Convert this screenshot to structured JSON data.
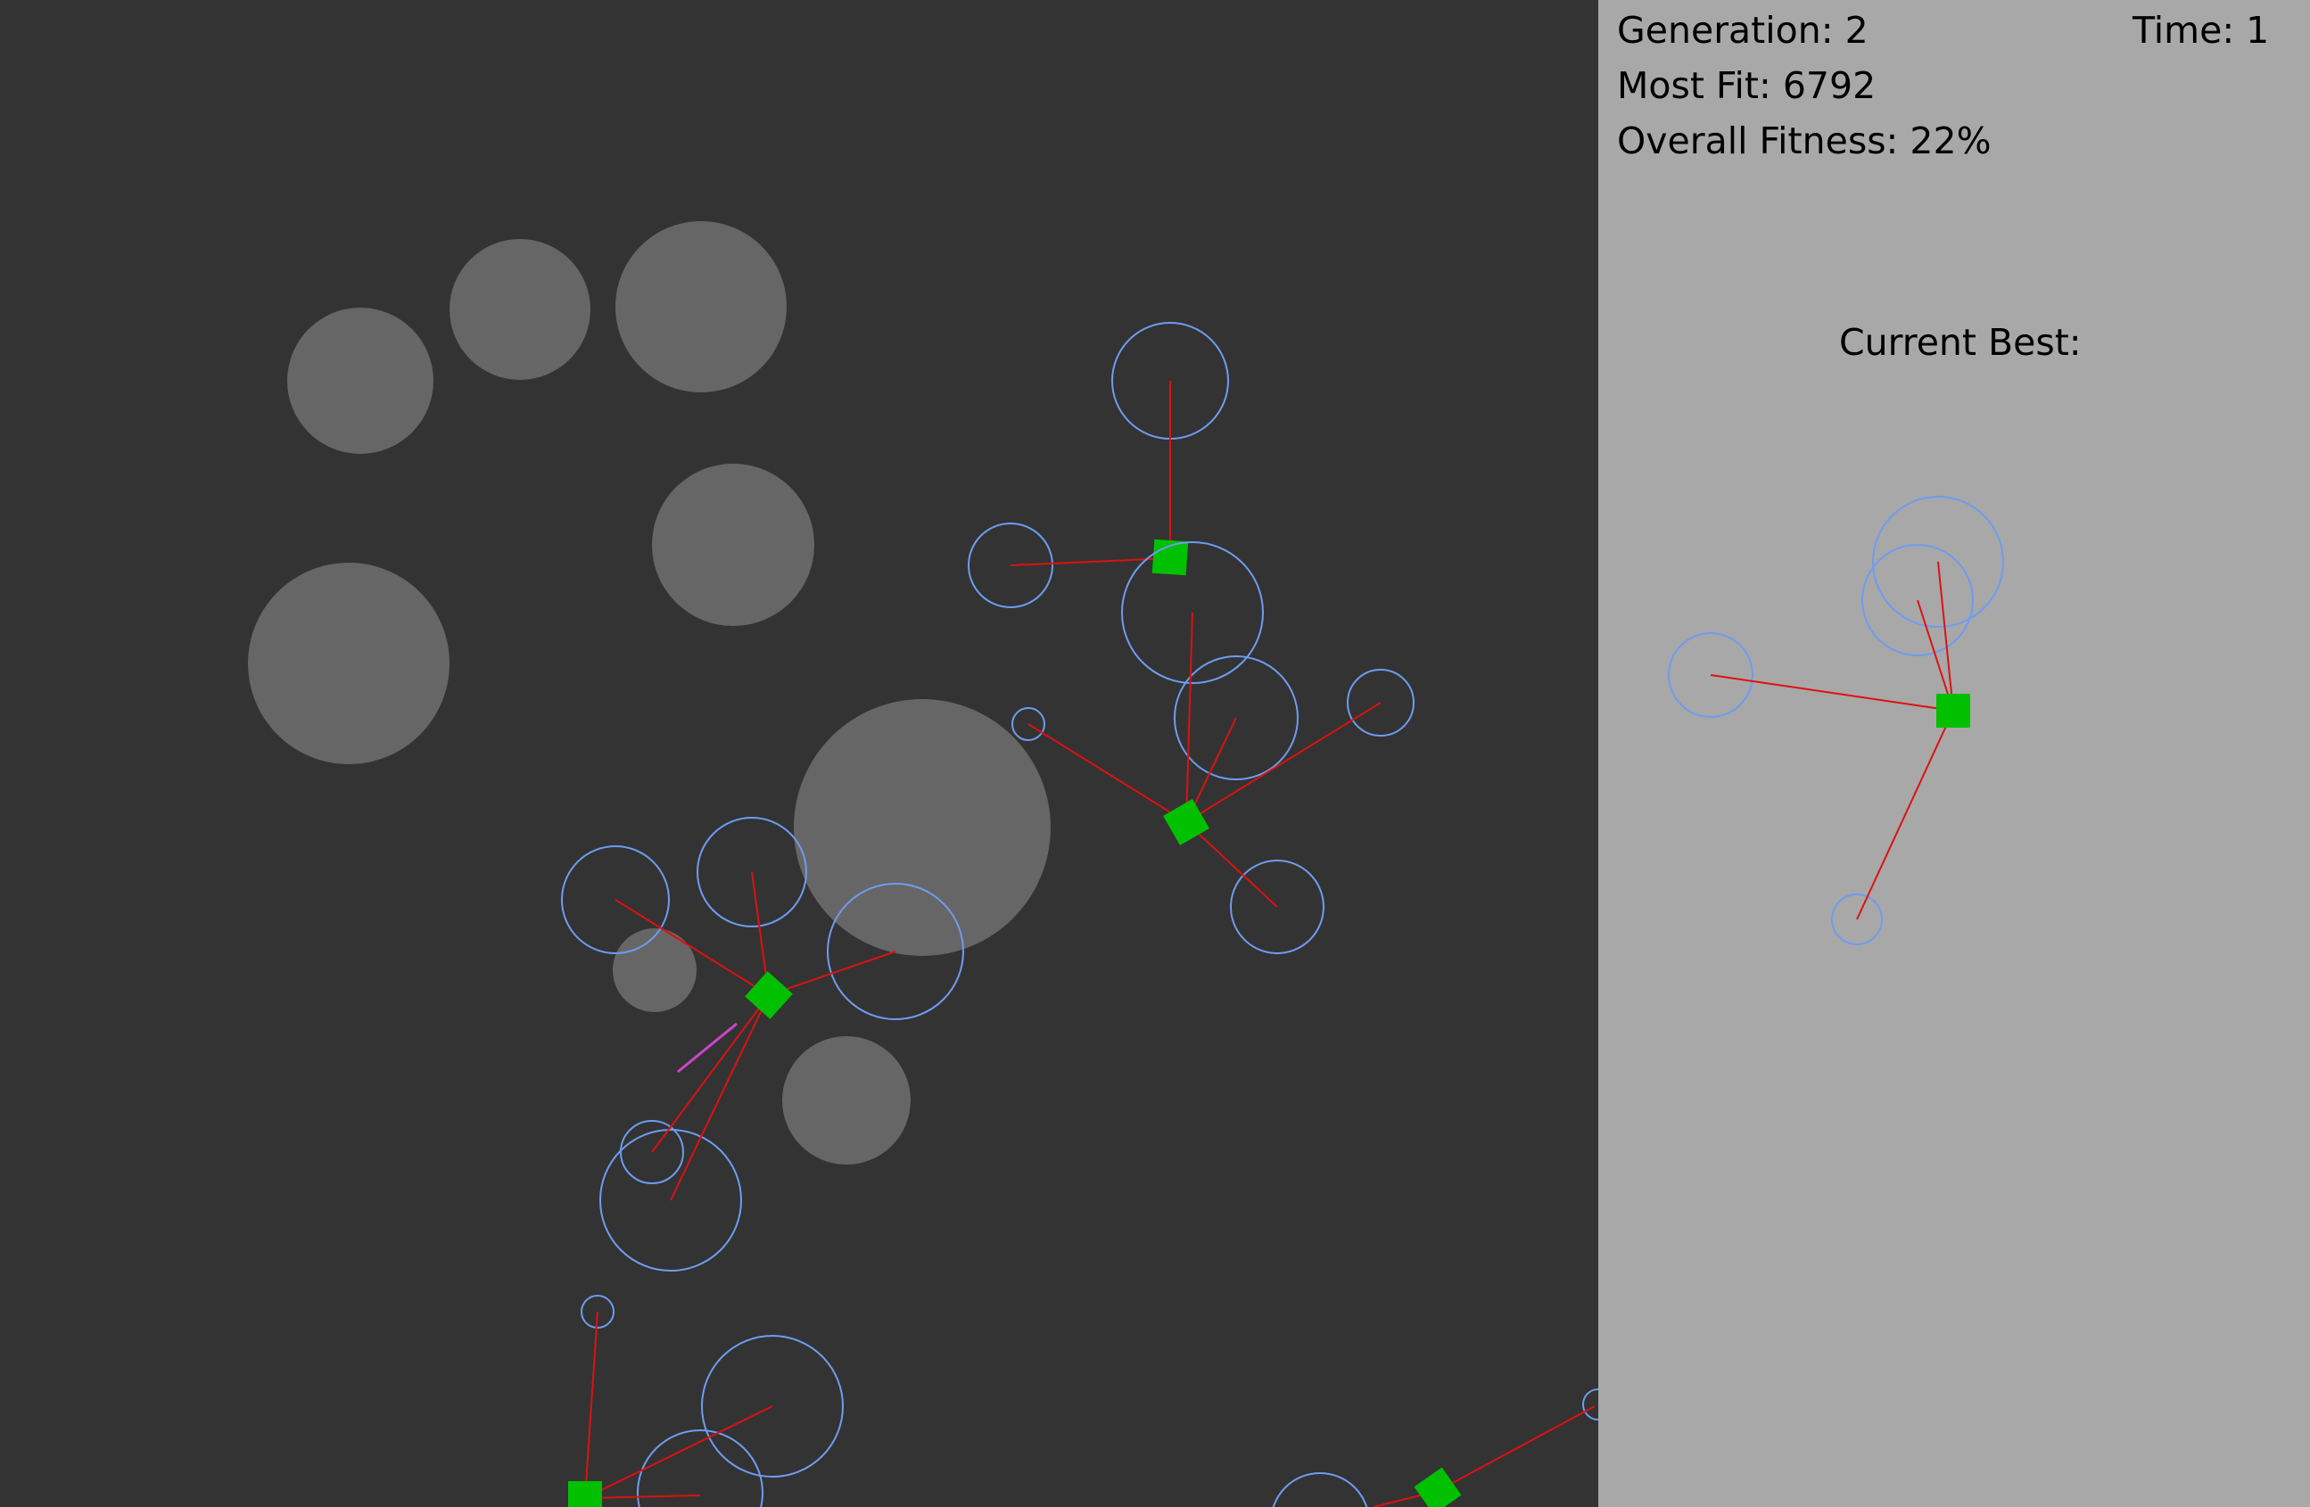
{
  "hud": {
    "generation": "Generation: 2",
    "time": "Time: 1",
    "most_fit": "Most Fit: 6792",
    "overall_fitness": "Overall Fitness: 22%",
    "current_best_label": "Current Best:"
  },
  "colors": {
    "arena_bg": "#333333",
    "panel_bg": "#a8a8a8",
    "obstacle": "#666666",
    "creature_body": "#00c000",
    "limb": "#dd1111",
    "limb_tip_circle": "#6e9cf0",
    "highlight_limb": "#cc44cc"
  },
  "icons": {
    "obstacle": "grey-circle-obstacle",
    "creature": "green-square-creature",
    "limb": "red-line-limb",
    "limb_tip": "blue-ring-sensor"
  }
}
